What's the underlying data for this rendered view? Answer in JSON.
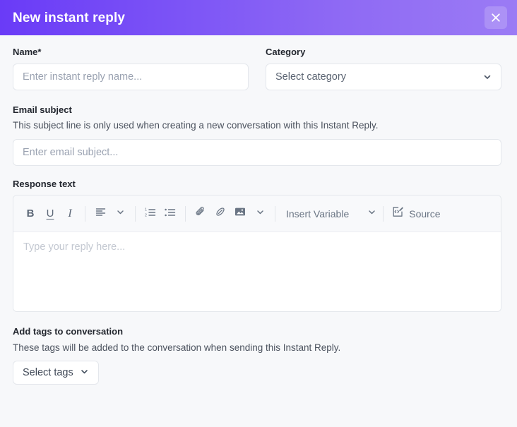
{
  "header": {
    "title": "New instant reply",
    "close_icon": "close-icon",
    "gradient_from": "#6a3bf7",
    "gradient_to": "#9b7bf5",
    "title_color": "#ffffff"
  },
  "form": {
    "name": {
      "label": "Name*",
      "placeholder": "Enter instant reply name...",
      "value": ""
    },
    "category": {
      "label": "Category",
      "selected": "Select category",
      "chevron_icon": "chevron-down-icon"
    },
    "email_subject": {
      "label": "Email subject",
      "help": "This subject line is only used when creating a new conversation with this Instant Reply.",
      "placeholder": "Enter email subject...",
      "value": ""
    },
    "response_text": {
      "label": "Response text",
      "placeholder": "Type your reply here...",
      "value": "",
      "toolbar": {
        "bold_label": "B",
        "underline_label": "U",
        "italic_label": "I",
        "align_icon": "align-left-icon",
        "align_chevron_icon": "chevron-down-icon",
        "numbered_list_icon": "numbered-list-icon",
        "bullet_list_icon": "bullet-list-icon",
        "attachment_icon": "paperclip-icon",
        "link_icon": "link-icon",
        "image_icon": "image-icon",
        "image_chevron_icon": "chevron-down-icon",
        "insert_variable_label": "Insert Variable",
        "insert_variable_chevron_icon": "chevron-down-icon",
        "source_label": "Source",
        "source_icon": "source-code-icon"
      }
    },
    "tags": {
      "label": "Add tags to conversation",
      "help": "These tags will be added to the conversation when sending this Instant Reply.",
      "button_label": "Select tags",
      "chevron_icon": "chevron-down-icon"
    }
  },
  "colors": {
    "page_background": "#f7f8fa",
    "input_border": "#e4e7ec",
    "toolbar_background": "#f8f9fb",
    "icon_gray": "#6a7584",
    "placeholder_gray": "#9aa2b1"
  }
}
